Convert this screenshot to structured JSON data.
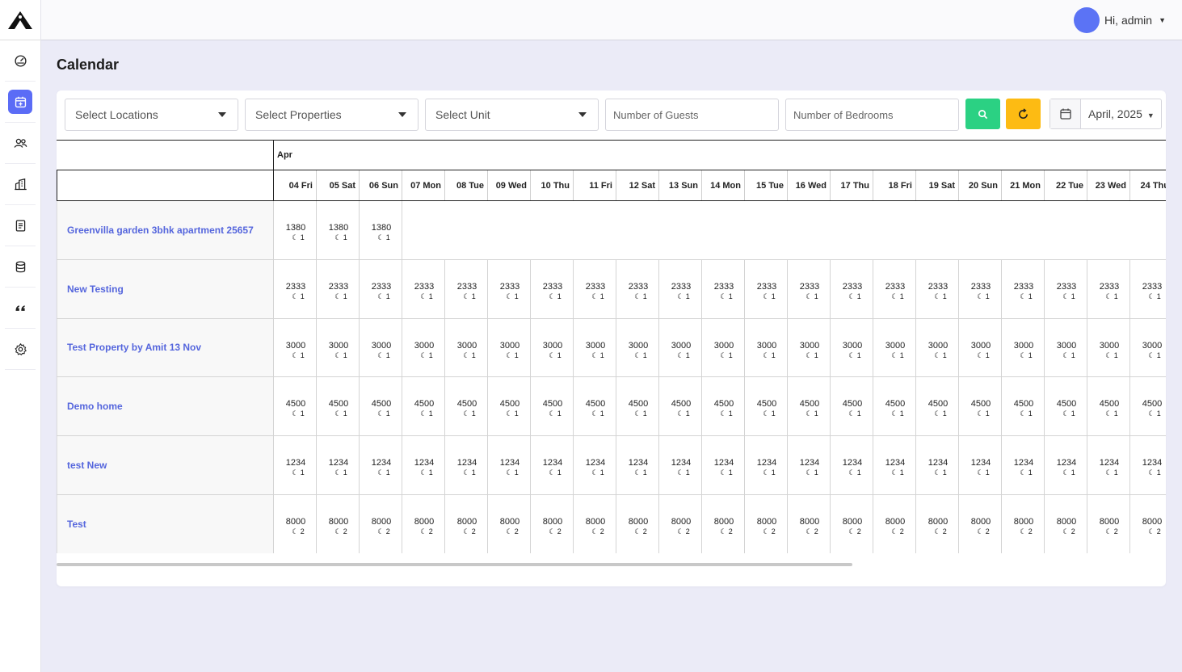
{
  "user": {
    "greeting": "Hi, admin"
  },
  "page": {
    "title": "Calendar"
  },
  "filters": {
    "locations": "Select Locations",
    "properties": "Select Properties",
    "unit": "Select Unit",
    "guests_placeholder": "Number of Guests",
    "bedrooms_placeholder": "Number of Bedrooms",
    "month": "April, 2025"
  },
  "calendar": {
    "month": "Apr",
    "days": [
      "04 Fri",
      "05 Sat",
      "06 Sun",
      "07 Mon",
      "08 Tue",
      "09 Wed",
      "10 Thu",
      "11 Fri",
      "12 Sat",
      "13 Sun",
      "14 Mon",
      "15 Tue",
      "16 Wed",
      "17 Thu",
      "18 Fri",
      "19 Sat",
      "20 Sun",
      "21 Mon",
      "22 Tue",
      "23 Wed",
      "24 Thu"
    ],
    "properties": [
      {
        "name": "Greenvilla garden  3bhk apartment 25657",
        "price": "1380",
        "nights": "1",
        "count": 3
      },
      {
        "name": "New Testing",
        "price": "2333",
        "nights": "1",
        "count": 21
      },
      {
        "name": "Test Property by Amit 13 Nov",
        "price": "3000",
        "nights": "1",
        "count": 21
      },
      {
        "name": "Demo home",
        "price": "4500",
        "nights": "1",
        "count": 21
      },
      {
        "name": "test New",
        "price": "1234",
        "nights": "1",
        "count": 21
      },
      {
        "name": "Test",
        "price": "8000",
        "nights": "2",
        "count": 21
      }
    ]
  },
  "icons": {
    "sidebar": [
      "dashboard-icon",
      "calendar-icon",
      "users-icon",
      "building-icon",
      "report-icon",
      "database-icon",
      "quote-icon",
      "gear-icon"
    ]
  }
}
